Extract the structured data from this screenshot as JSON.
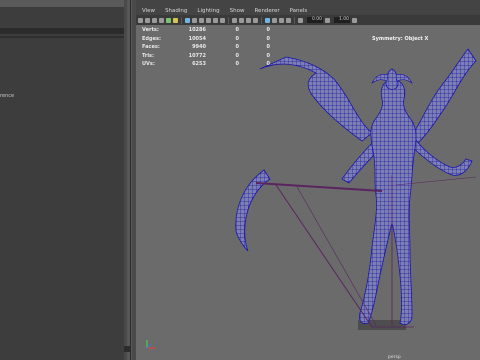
{
  "left_panel": {
    "reference_text": "rence"
  },
  "viewport": {
    "menu": [
      "View",
      "Shading",
      "Lighting",
      "Show",
      "Renderer",
      "Panels"
    ],
    "toolbar": {
      "field_1": "0.00",
      "field_2": "1.00"
    },
    "hud": {
      "rows": [
        {
          "label": "Verts:",
          "total": "10286",
          "selected": "0",
          "triangles": "0"
        },
        {
          "label": "Edges:",
          "total": "10054",
          "selected": "0",
          "triangles": "0"
        },
        {
          "label": "Faces:",
          "total": "9940",
          "selected": "0",
          "triangles": "0"
        },
        {
          "label": "Tris:",
          "total": "10772",
          "selected": "0",
          "triangles": "0"
        },
        {
          "label": "UVs:",
          "total": "6253",
          "selected": "0",
          "triangles": "0"
        }
      ]
    },
    "symmetry_text": "Symmetry: Object X",
    "camera_name": "persp",
    "colors": {
      "background": "#6b6b6b",
      "wireframe": "#1a16a8",
      "mesh_fill": "#7d7fb3",
      "selection": "#5a2460"
    }
  }
}
